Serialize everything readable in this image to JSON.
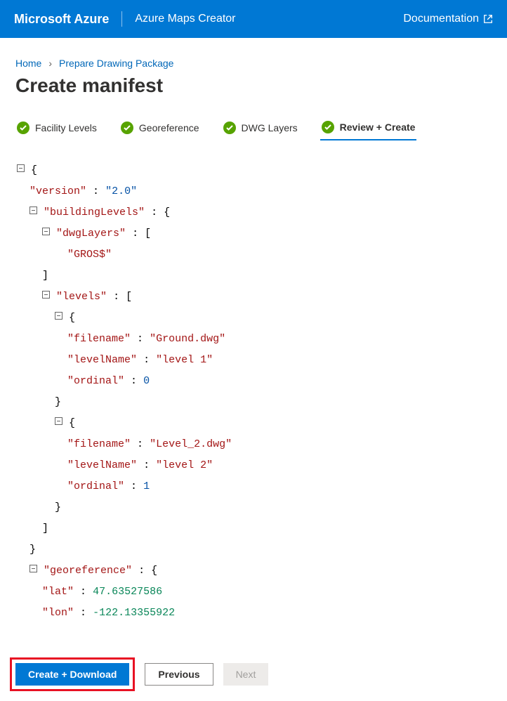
{
  "topbar": {
    "brand": "Microsoft Azure",
    "product": "Azure Maps Creator",
    "docLink": "Documentation"
  },
  "breadcrumb": {
    "home": "Home",
    "current": "Prepare Drawing Package"
  },
  "pageTitle": "Create manifest",
  "steps": [
    {
      "label": "Facility Levels"
    },
    {
      "label": "Georeference"
    },
    {
      "label": "DWG Layers"
    },
    {
      "label": "Review + Create"
    }
  ],
  "manifest": {
    "version": "2.0",
    "buildingLevels": {
      "dwgLayers": [
        "GROS$"
      ],
      "levels": [
        {
          "filename": "Ground.dwg",
          "levelName": "level 1",
          "ordinal": 0
        },
        {
          "filename": "Level_2.dwg",
          "levelName": "level 2",
          "ordinal": 1
        }
      ]
    },
    "georeference": {
      "lat": 47.63527586,
      "lon": -122.13355922
    }
  },
  "footer": {
    "create": "Create + Download",
    "previous": "Previous",
    "next": "Next"
  }
}
